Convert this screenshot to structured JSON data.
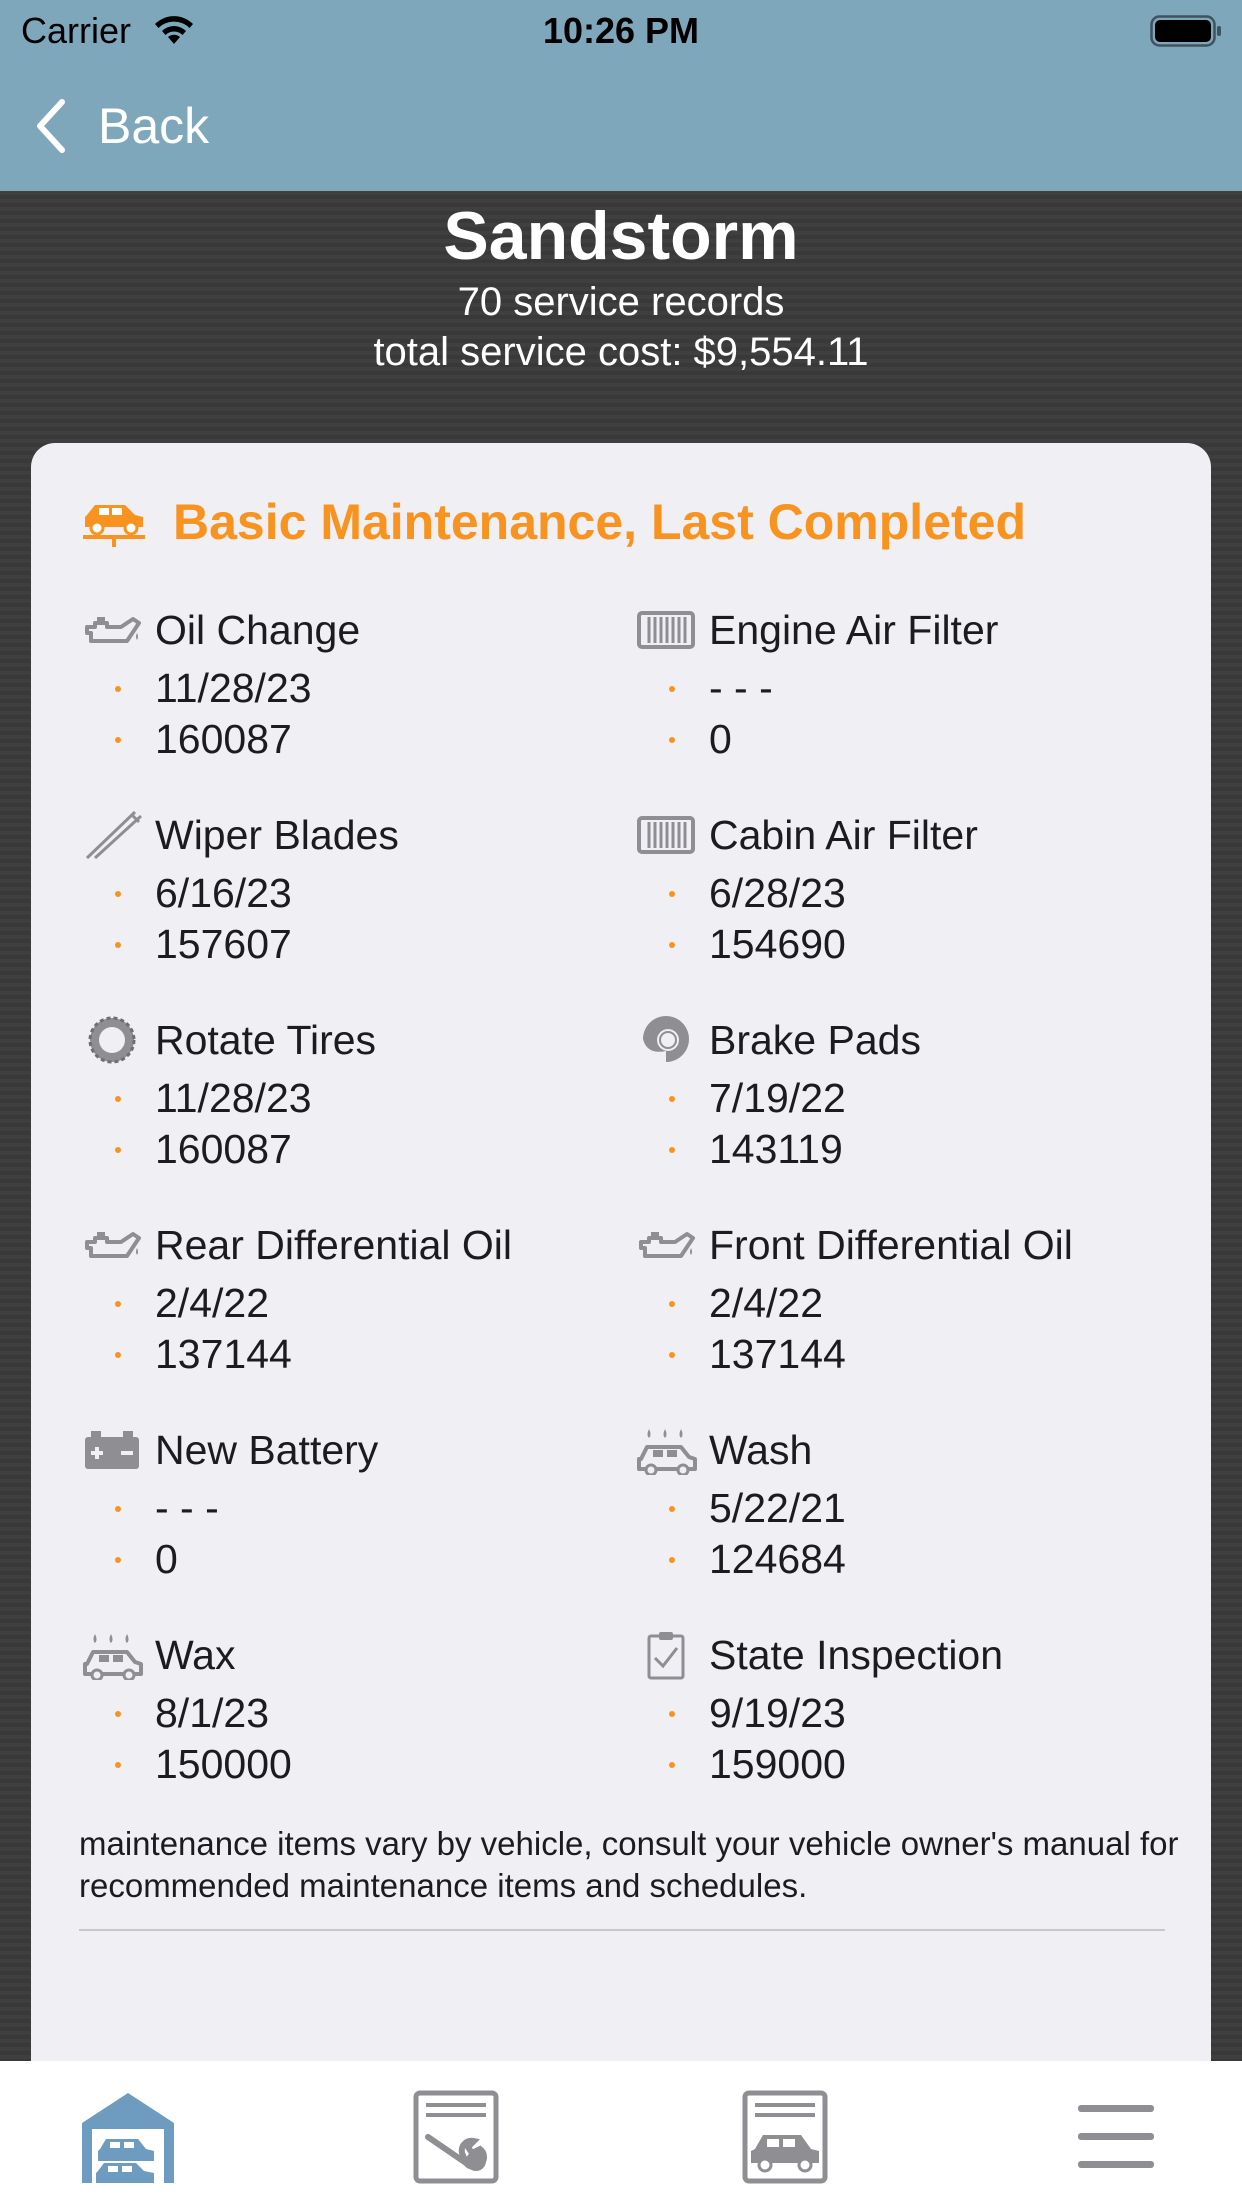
{
  "status": {
    "carrier": "Carrier",
    "time": "10:26 PM"
  },
  "nav": {
    "back_label": "Back"
  },
  "vehicle": {
    "name": "Sandstorm",
    "records": "70 service records",
    "cost": "total service cost: $9,554.11"
  },
  "card": {
    "title": "Basic Maintenance, Last Completed",
    "accent": "#f7931e",
    "items": [
      {
        "label": "Oil Change",
        "date": "11/28/23",
        "mileage": "160087",
        "icon": "oil-can-icon"
      },
      {
        "label": "Engine Air Filter",
        "date": "- - -",
        "mileage": "0",
        "icon": "air-filter-icon"
      },
      {
        "label": "Wiper Blades",
        "date": "6/16/23",
        "mileage": "157607",
        "icon": "wiper-icon"
      },
      {
        "label": "Cabin Air Filter",
        "date": "6/28/23",
        "mileage": "154690",
        "icon": "air-filter-icon"
      },
      {
        "label": "Rotate Tires",
        "date": "11/28/23",
        "mileage": "160087",
        "icon": "tire-icon"
      },
      {
        "label": "Brake Pads",
        "date": "7/19/22",
        "mileage": "143119",
        "icon": "brake-icon"
      },
      {
        "label": "Rear Differential Oil",
        "date": "2/4/22",
        "mileage": "137144",
        "icon": "oil-can-icon"
      },
      {
        "label": "Front Differential Oil",
        "date": "2/4/22",
        "mileage": "137144",
        "icon": "oil-can-icon"
      },
      {
        "label": "New Battery",
        "date": "- - -",
        "mileage": "0",
        "icon": "battery-icon"
      },
      {
        "label": "Wash",
        "date": "5/22/21",
        "mileage": "124684",
        "icon": "car-wash-icon"
      },
      {
        "label": "Wax",
        "date": "8/1/23",
        "mileage": "150000",
        "icon": "car-wash-icon"
      },
      {
        "label": "State Inspection",
        "date": "9/19/23",
        "mileage": "159000",
        "icon": "checklist-icon"
      }
    ],
    "note": "maintenance items vary by vehicle, consult your vehicle owner's manual for recommended maintenance items and schedules."
  },
  "tabs": [
    {
      "name": "garage",
      "icon": "garage-icon",
      "active": true
    },
    {
      "name": "service",
      "icon": "service-log-icon",
      "active": false
    },
    {
      "name": "vehicle-log",
      "icon": "vehicle-log-icon",
      "active": false
    },
    {
      "name": "menu",
      "icon": "menu-icon",
      "active": false
    }
  ]
}
